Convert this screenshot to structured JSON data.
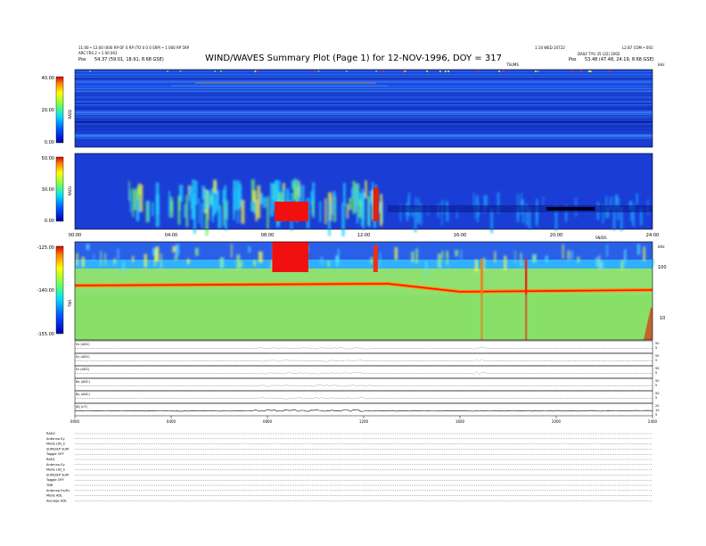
{
  "header": {
    "title": "WIND/WAVES Summary Plot (Page 1) for 12-NOV-1996, DOY = 317",
    "left_line1": "11:00 • 12:00 (000 RP OF 0 RP (TO 0 0 0 SRP) • 1 000 RP 5RP",
    "left_line2": "ARC FRS 2 • 1 00 001",
    "left_pos_label": "Pos",
    "left_pos_value": "54.37 (59.01, 18.91, 8.68 GSE)",
    "right_line1": "1:10 WED 20722",
    "right_line2": "L2 B7 COM • 001",
    "right_line3": "DAILY TYU 35 (22) 2002",
    "right_pos_label": "Pos",
    "right_pos_value": "53.48 (47.48, 24.19, 8.68 GSE)",
    "center_small": "TSUMS",
    "right_corner": "kHz"
  },
  "colors": {
    "bg_low": "#1030c8",
    "bg_mid": "#10a0ff",
    "green": "#80e060",
    "yellow": "#f0f040",
    "red": "#f01010"
  },
  "chart_data": [
    {
      "type": "heatmap",
      "name": "RAD2",
      "ylabel": "RAD2",
      "colorbar_ticks": [
        "40.00",
        "20.00",
        "0.00"
      ],
      "ylim": [
        0,
        40
      ]
    },
    {
      "type": "heatmap",
      "name": "RAD1",
      "ylabel": "RAD1",
      "colorbar_ticks": [
        "50.00",
        "30.00",
        "0.00"
      ],
      "ylim": [
        0,
        50
      ],
      "x_tick_labels": [
        "00:00",
        "04:00",
        "08:00",
        "12:00",
        "16:00",
        "20:00",
        "24:00"
      ],
      "corner_label": "SN/DS"
    },
    {
      "type": "heatmap",
      "name": "TNR",
      "ylabel": "TNR",
      "colorbar_ticks": [
        "-125.00",
        "-140.00",
        "-155.00"
      ],
      "ylim": [
        -155,
        -125
      ],
      "right_ticks": [
        "100",
        "10"
      ],
      "right_unit": "kHz"
    },
    {
      "type": "line",
      "name": "strips",
      "rows": [
        {
          "label": "Ex (ADC)",
          "right_ticks": [
            "50",
            "5"
          ]
        },
        {
          "label": "Ey (ADC)",
          "right_ticks": [
            "50",
            "5"
          ]
        },
        {
          "label": "Ez (ADC)",
          "right_ticks": [
            "50",
            "5"
          ]
        },
        {
          "label": "Bx (ADC)",
          "right_ticks": [
            "50",
            "5"
          ]
        },
        {
          "label": "By (ADC)",
          "right_ticks": [
            "50",
            "5"
          ]
        },
        {
          "label": "|B| (nT)",
          "right_ticks": [
            "20",
            "10",
            "5"
          ]
        }
      ],
      "x_tick_labels": [
        "0000",
        "0400",
        "0800",
        "1200",
        "1600",
        "2000",
        "2400"
      ]
    }
  ],
  "footer": {
    "lines": [
      "RAD2",
      "Antenna  Ey",
      "Mode  LIN_S",
      "SUM/SEP SUM",
      "Toggle  OFF",
      "RAD1",
      "Antenna  Ey",
      "Mode  LIN_S",
      "SUM/SEP SUM",
      "Toggle  OFF",
      "TNR",
      "Antenna  Ex/Ey",
      "Mode  ADL",
      "Average  ADL"
    ]
  }
}
